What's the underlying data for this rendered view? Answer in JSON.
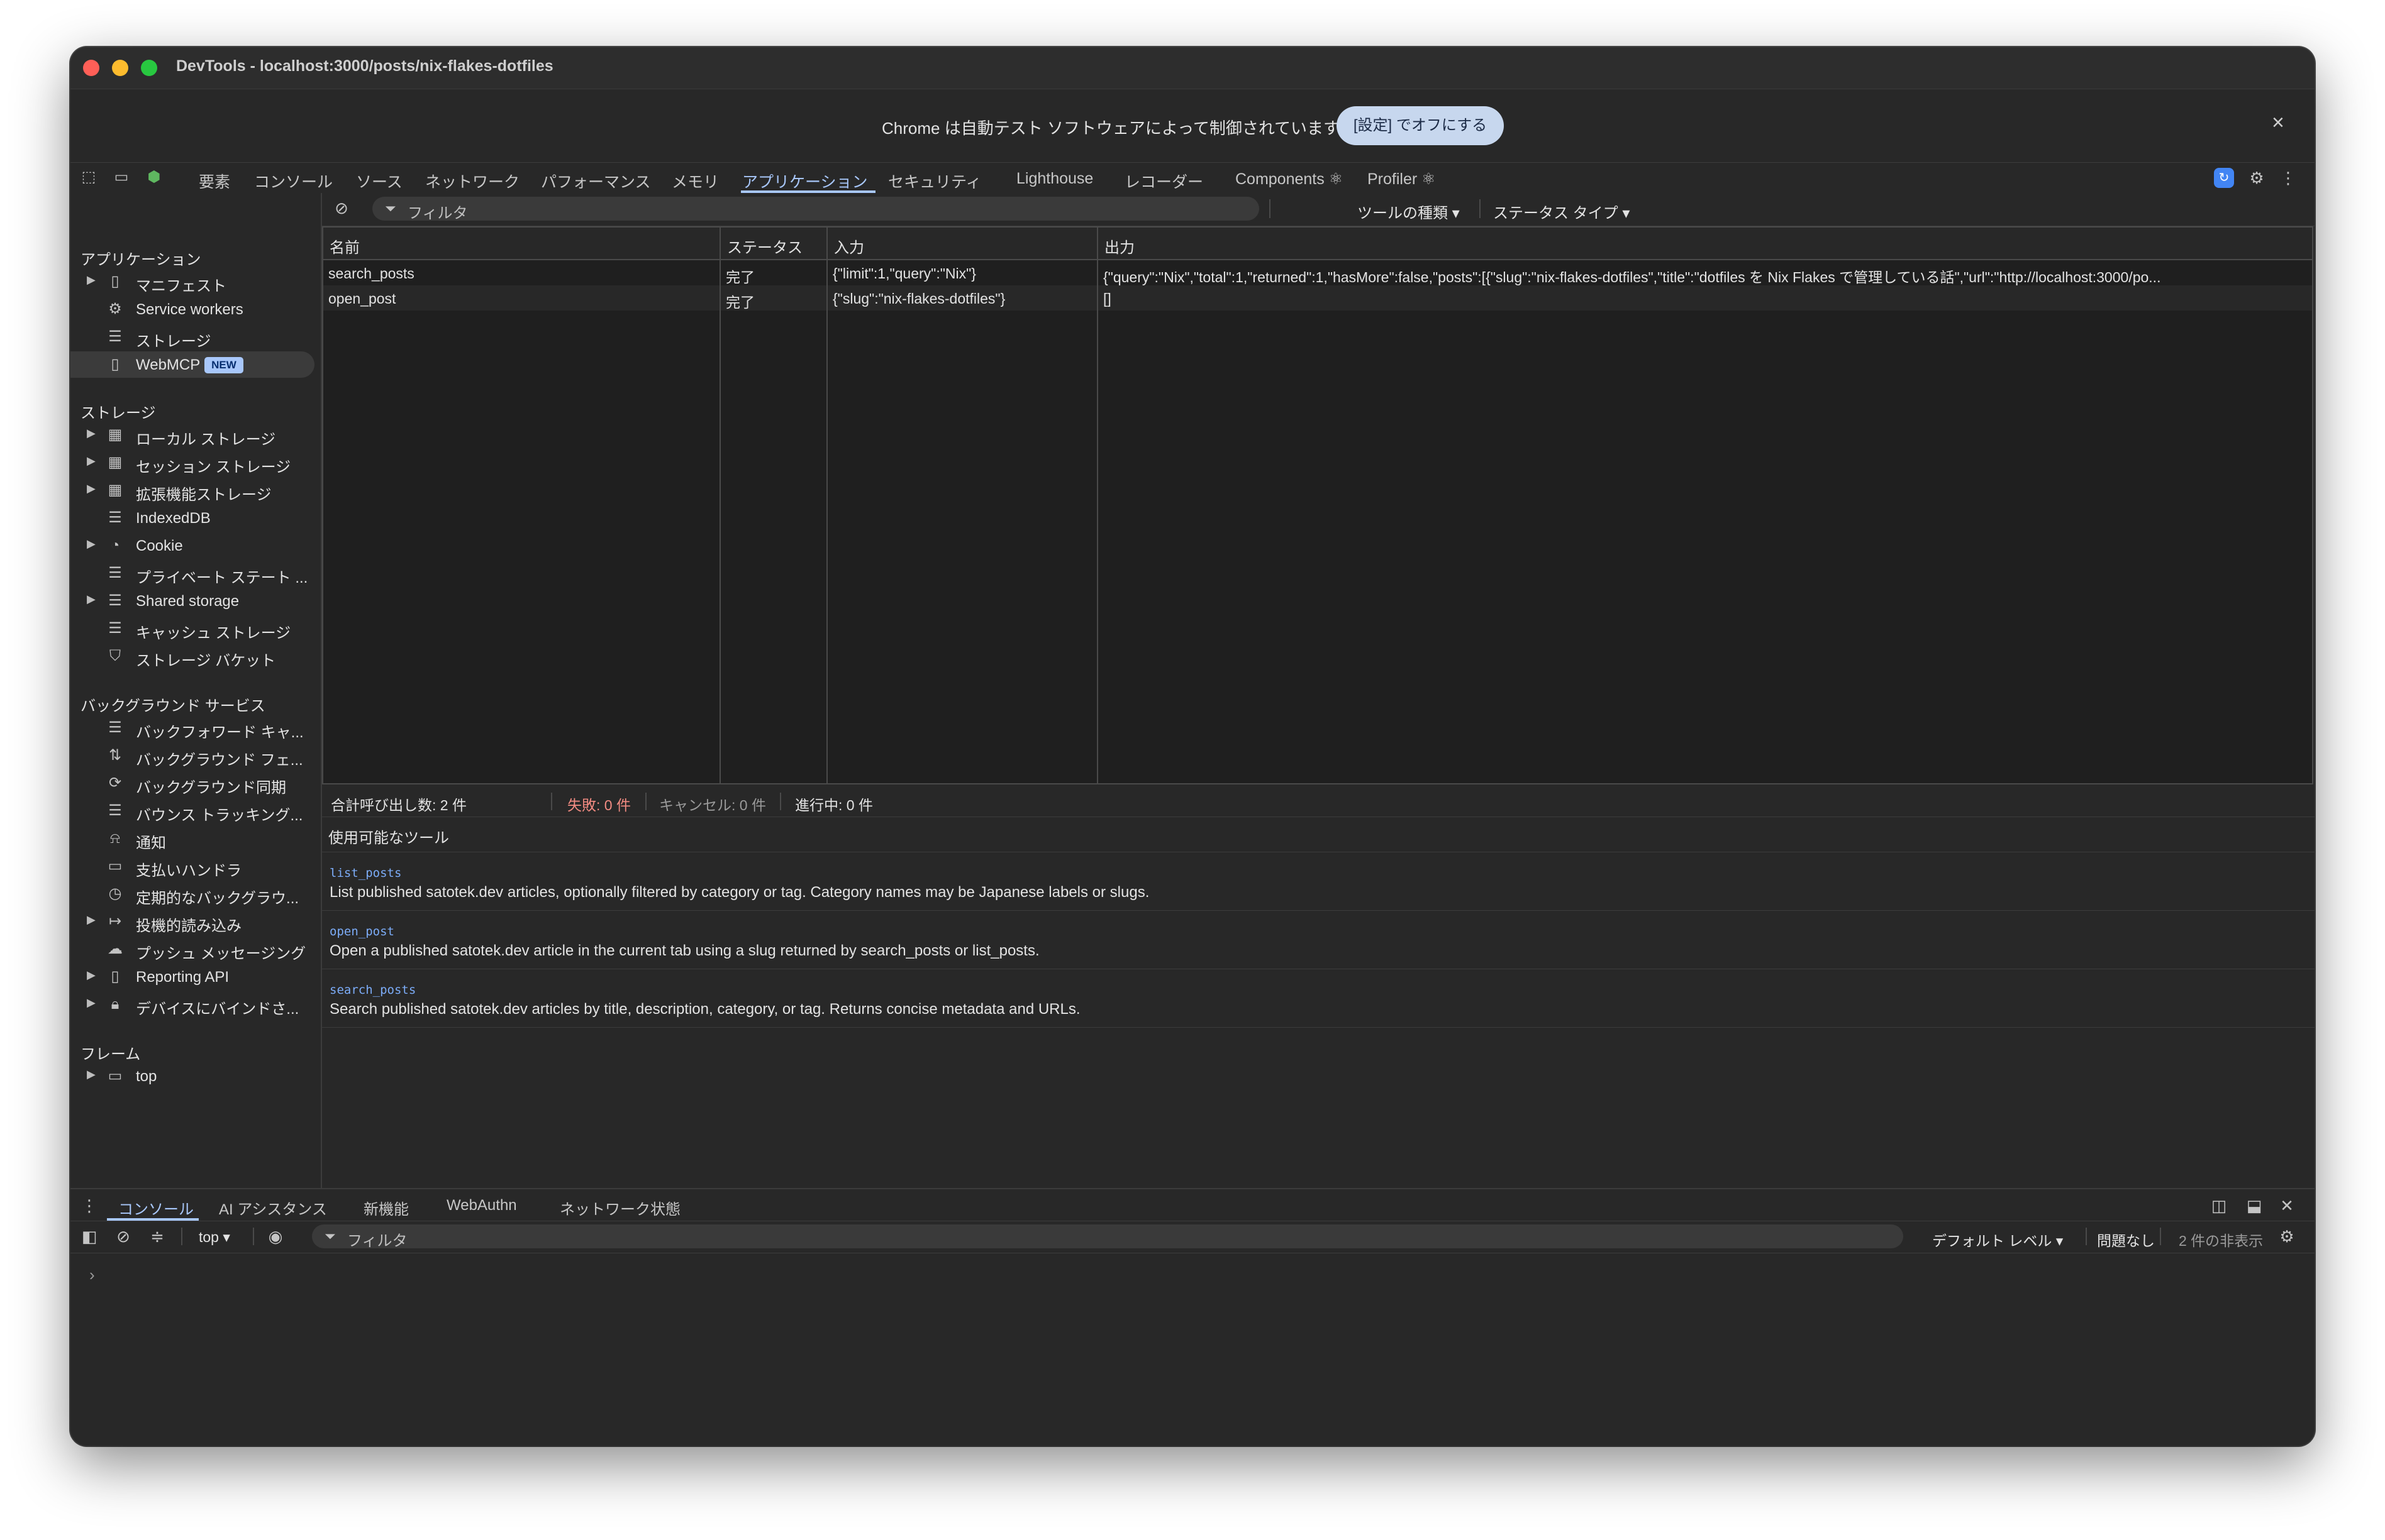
{
  "window": {
    "title": "DevTools - localhost:3000/posts/nix-flakes-dotfiles"
  },
  "infobar": {
    "message": "Chrome は自動テスト ソフトウェアによって制御されています",
    "button": "[設定] でオフにする",
    "close": "×"
  },
  "toolbar": {
    "tabs": [
      "要素",
      "コンソール",
      "ソース",
      "ネットワーク",
      "パフォーマンス",
      "メモリ",
      "アプリケーション",
      "セキュリティ",
      "Lighthouse",
      "レコーダー",
      "Components ⚛",
      "Profiler ⚛"
    ],
    "active_tab": "アプリケーション"
  },
  "sidebar": {
    "sections": [
      {
        "title": "アプリケーション",
        "items": [
          "マニフェスト",
          "Service workers",
          "ストレージ",
          "WebMCP"
        ]
      },
      {
        "title": "ストレージ",
        "items": [
          "ローカル ストレージ",
          "セッション ストレージ",
          "拡張機能ストレージ",
          "IndexedDB",
          "Cookie",
          "プライベート ステート ...",
          "Shared storage",
          "キャッシュ ストレージ",
          "ストレージ バケット"
        ]
      },
      {
        "title": "バックグラウンド サービス",
        "items": [
          "バックフォワード キャ...",
          "バックグラウンド フェ...",
          "バックグラウンド同期",
          "バウンス トラッキング...",
          "通知",
          "支払いハンドラ",
          "定期的なバックグラウ...",
          "投機的読み込み",
          "プッシュ メッセージング",
          "Reporting API",
          "デバイスにバインドさ..."
        ]
      },
      {
        "title": "フレーム",
        "items": [
          "top"
        ]
      }
    ],
    "new_badge": "NEW"
  },
  "filterbar": {
    "placeholder": "フィルタ",
    "tool_type": "ツールの種類 ▾",
    "status_type": "ステータス タイプ ▾"
  },
  "table": {
    "headers": [
      "名前",
      "ステータス",
      "入力",
      "出力"
    ],
    "rows": [
      {
        "name": "search_posts",
        "status": "完了",
        "input": "{\"limit\":1,\"query\":\"Nix\"}",
        "output": "{\"query\":\"Nix\",\"total\":1,\"returned\":1,\"hasMore\":false,\"posts\":[{\"slug\":\"nix-flakes-dotfiles\",\"title\":\"dotfiles を Nix Flakes で管理している話\",\"url\":\"http://localhost:3000/po..."
      },
      {
        "name": "open_post",
        "status": "完了",
        "input": "{\"slug\":\"nix-flakes-dotfiles\"}",
        "output": "[]"
      }
    ]
  },
  "summary": {
    "total": "合計呼び出し数: 2 件",
    "failed": "失敗: 0 件",
    "canceled": "キャンセル: 0 件",
    "in_progress": "進行中: 0 件"
  },
  "tools": {
    "heading": "使用可能なツール",
    "items": [
      {
        "name": "list_posts",
        "desc": "List published satotek.dev articles, optionally filtered by category or tag. Category names may be Japanese labels or slugs."
      },
      {
        "name": "open_post",
        "desc": "Open a published satotek.dev article in the current tab using a slug returned by search_posts or list_posts."
      },
      {
        "name": "search_posts",
        "desc": "Search published satotek.dev articles by title, description, category, or tag. Returns concise metadata and URLs."
      }
    ]
  },
  "drawer": {
    "tabs": [
      "コンソール",
      "AI アシスタンス",
      "新機能",
      "WebAuthn",
      "ネットワーク状態"
    ],
    "active_tab": "コンソール"
  },
  "console": {
    "context": "top ▾",
    "filter_placeholder": "フィルタ",
    "level": "デフォルト レベル ▾",
    "issues": "問題なし",
    "hidden": "2 件の非表示",
    "prompt": "›"
  }
}
